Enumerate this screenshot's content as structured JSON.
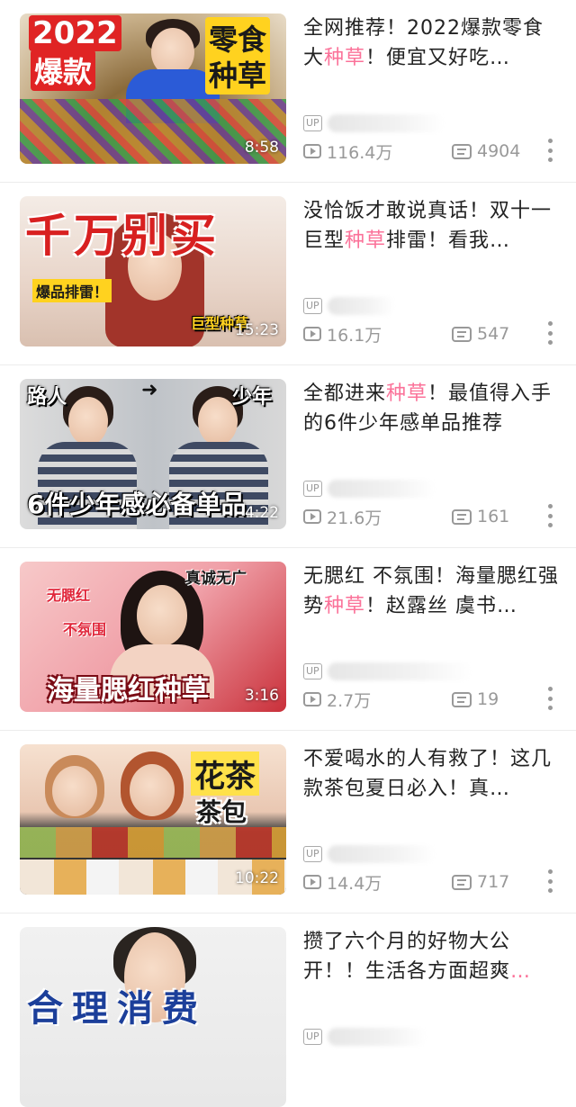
{
  "colors": {
    "highlight": "#fb7299",
    "meta": "#999999"
  },
  "up_badge": "UP",
  "videos": [
    {
      "title_before": "全网推荐！2022爆款零食大",
      "title_hl": "种草",
      "title_after": "！便宜又好吃…",
      "duration": "8:58",
      "views": "116.4万",
      "danmaku": "4904",
      "thumb_texts": [
        "2022",
        "爆款",
        "零食",
        "种草"
      ]
    },
    {
      "title_before": "没恰饭才敢说真话！双十一巨型",
      "title_hl": "种草",
      "title_after": "排雷！看我…",
      "duration": "15:23",
      "views": "16.1万",
      "danmaku": "547",
      "thumb_texts": [
        "千万别买",
        "爆品排雷！",
        "巨型种草"
      ]
    },
    {
      "title_before": "全都进来",
      "title_hl": "种草",
      "title_after": "！最值得入手的6件少年感单品推荐",
      "duration": "4:22",
      "views": "21.6万",
      "danmaku": "161",
      "thumb_texts": [
        "路人",
        "少年",
        "6件少年感必备单品"
      ]
    },
    {
      "title_before": "无腮红 不氛围！海量腮红强势",
      "title_hl": "种草",
      "title_after": "！赵露丝 虞书…",
      "duration": "3:16",
      "views": "2.7万",
      "danmaku": "19",
      "thumb_texts": [
        "真诚无广",
        "无腮红",
        "不氛围",
        "海量腮红种草"
      ]
    },
    {
      "title_before": "不爱喝水的人有救了！这几款茶包夏日必入！真…",
      "title_hl": "",
      "title_after": "",
      "duration": "10:22",
      "views": "14.4万",
      "danmaku": "717",
      "thumb_texts": [
        "花茶",
        "茶包"
      ]
    },
    {
      "title_before": "攒了六个月的好物大公开！！生活各方面超爽",
      "title_hl": "",
      "title_after": "…",
      "duration": "",
      "views": "",
      "danmaku": "",
      "thumb_texts": [
        "合理消费"
      ]
    }
  ]
}
